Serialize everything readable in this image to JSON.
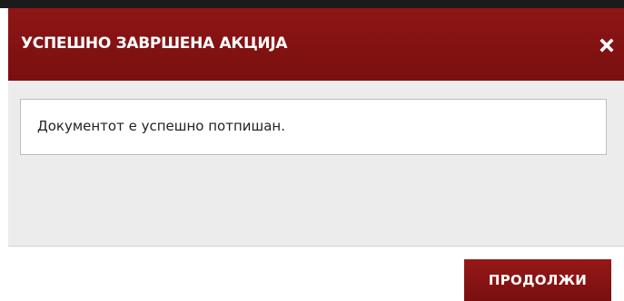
{
  "dialog": {
    "title": "УСПЕШНО ЗАВРШЕНА АКЦИЈА",
    "close_icon": "close-icon",
    "message": "Документот е успешно потпишан.",
    "continue_label": "ПРОДОЛЖИ"
  },
  "colors": {
    "header_bg": "#8e1616",
    "button_bg": "#951818",
    "dialog_bg": "#ececec",
    "top_strip": "#1b1b1b"
  }
}
